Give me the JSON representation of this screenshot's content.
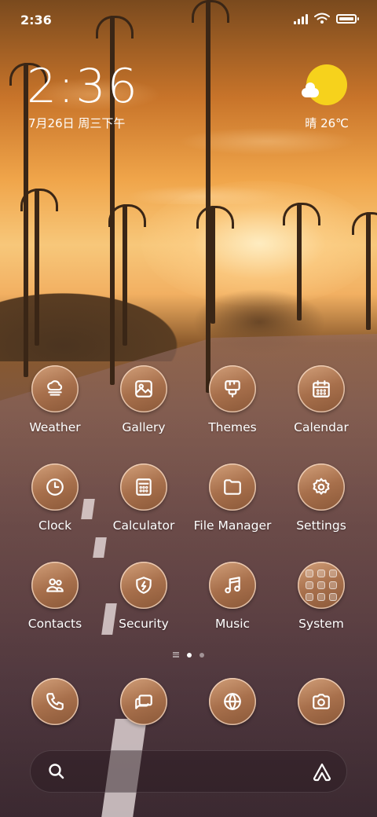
{
  "status_bar": {
    "time": "2:36"
  },
  "clock_widget": {
    "time": "2:36",
    "date": "7月26日 周三下午"
  },
  "weather_widget": {
    "text": "晴 26℃"
  },
  "apps": [
    {
      "label": "Weather",
      "icon": "weather-icon"
    },
    {
      "label": "Gallery",
      "icon": "gallery-icon"
    },
    {
      "label": "Themes",
      "icon": "themes-icon"
    },
    {
      "label": "Calendar",
      "icon": "calendar-icon"
    },
    {
      "label": "Clock",
      "icon": "clock-icon"
    },
    {
      "label": "Calculator",
      "icon": "calculator-icon"
    },
    {
      "label": "File Manager",
      "icon": "folder-icon"
    },
    {
      "label": "Settings",
      "icon": "gear-icon"
    },
    {
      "label": "Contacts",
      "icon": "contacts-icon"
    },
    {
      "label": "Security",
      "icon": "shield-icon"
    },
    {
      "label": "Music",
      "icon": "music-icon"
    },
    {
      "label": "System",
      "icon": "folder-grid-icon"
    }
  ],
  "dock": [
    {
      "icon": "phone-icon"
    },
    {
      "icon": "messages-icon"
    },
    {
      "icon": "browser-icon"
    },
    {
      "icon": "camera-icon"
    }
  ],
  "page_indicator": {
    "pages": 2,
    "active": 1
  },
  "colors": {
    "sun": "#f6d21c",
    "icon_bg": "#a8704c"
  }
}
